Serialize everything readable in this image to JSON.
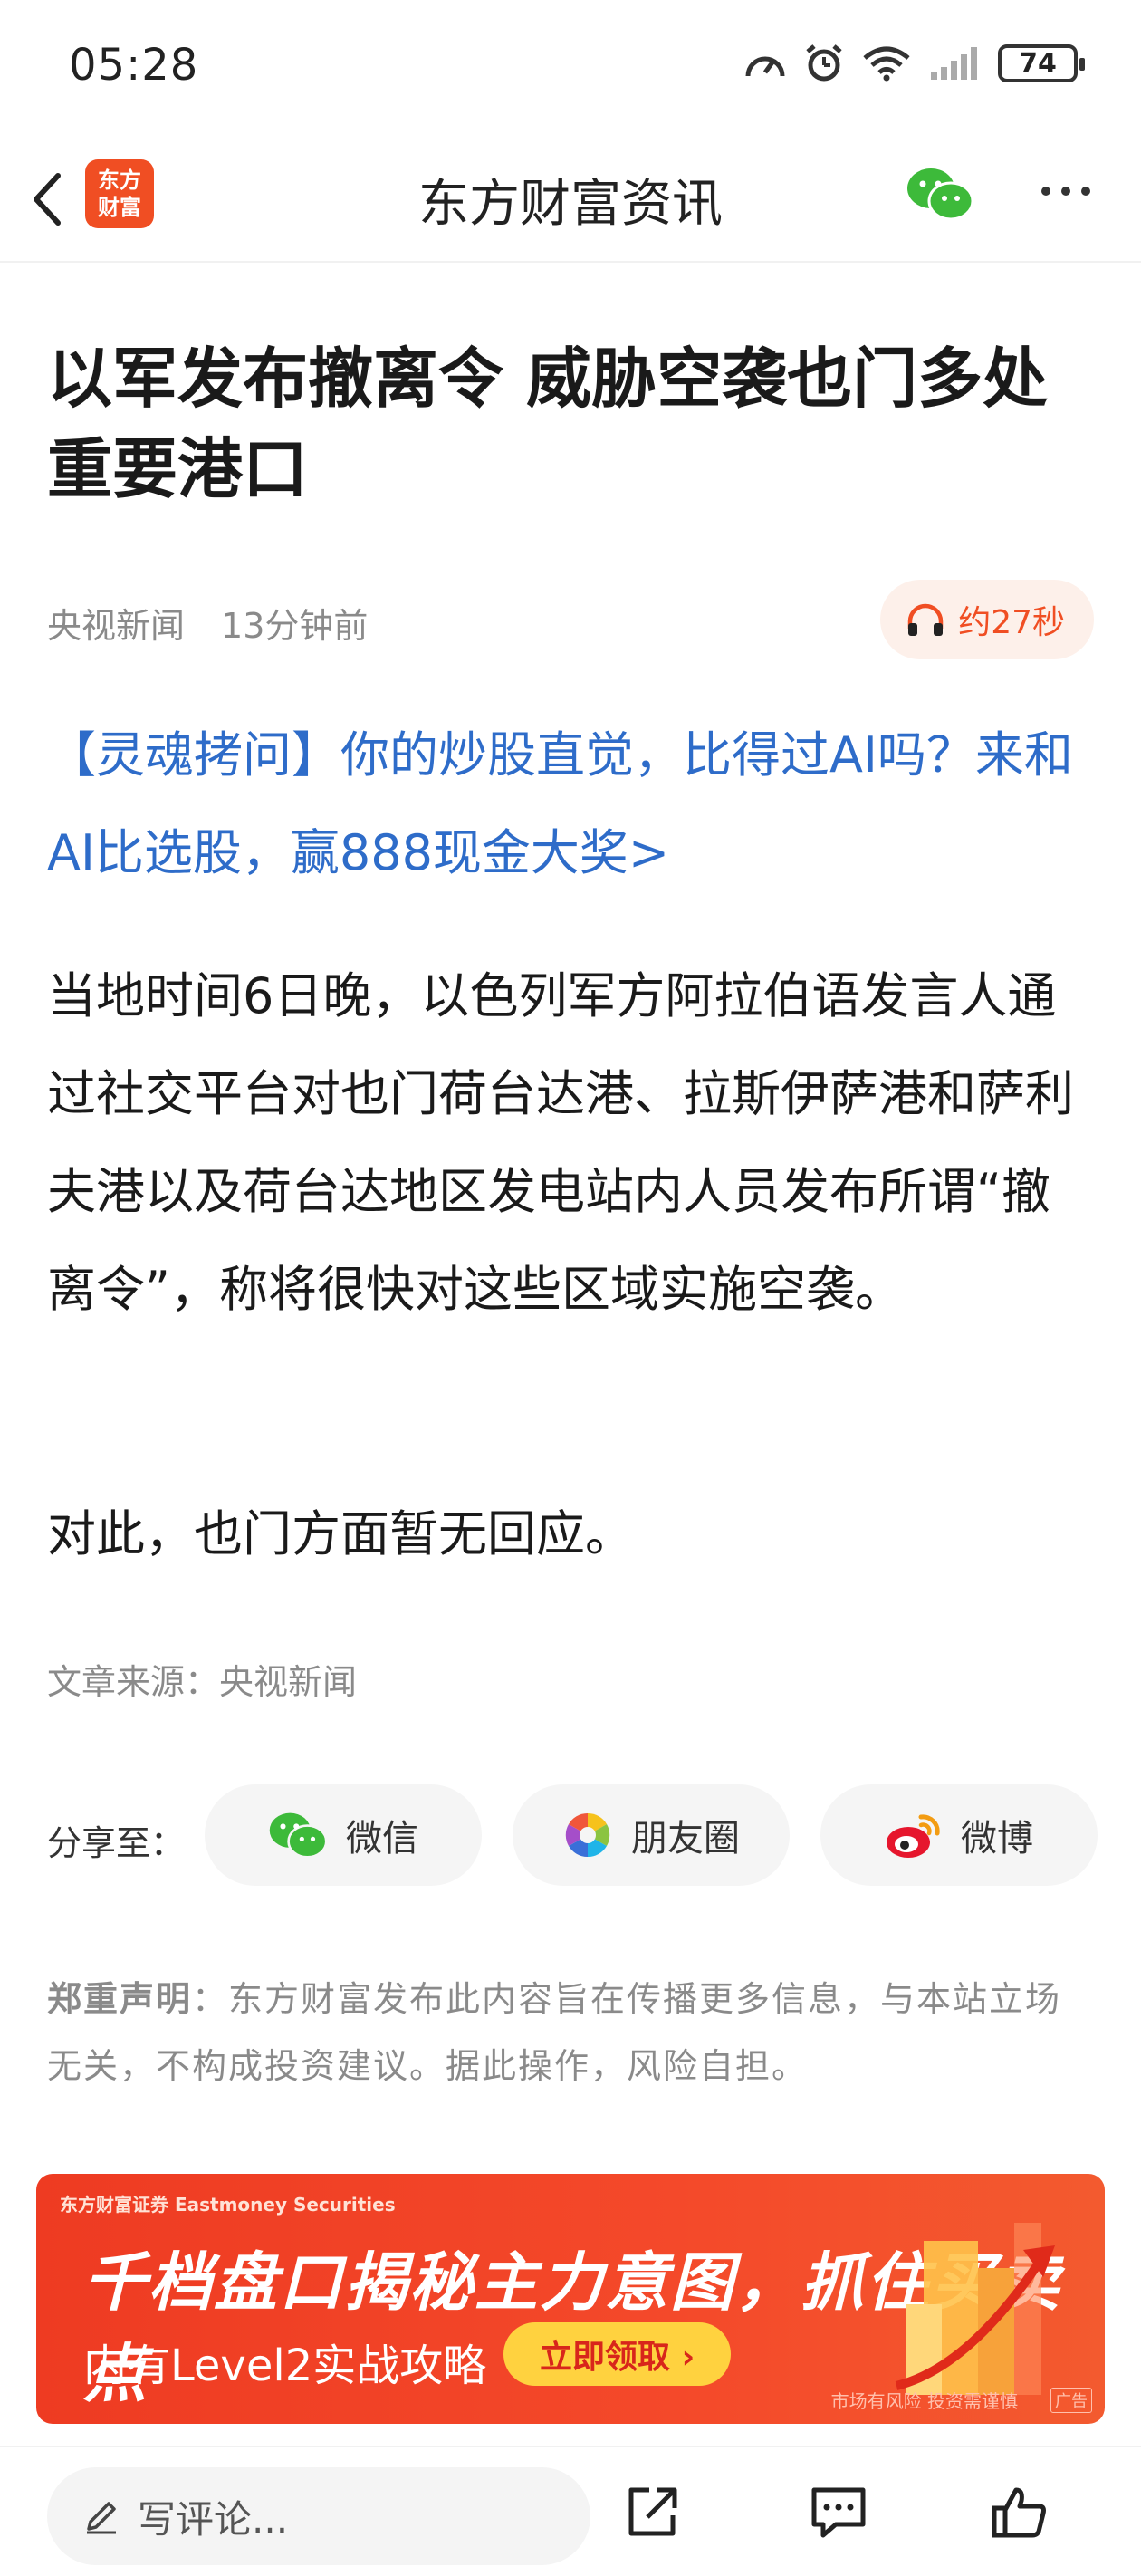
{
  "status_bar": {
    "time": "05:28",
    "battery": "74",
    "icons": [
      "speed-icon",
      "alarm-icon",
      "wifi-icon",
      "signal-icon",
      "battery-icon"
    ]
  },
  "nav": {
    "title": "东方财富资讯",
    "logo_line1": "东方",
    "logo_line2": "财富",
    "icons": [
      "back-icon",
      "wechat-icon",
      "more-icon"
    ]
  },
  "article": {
    "title": "以军发布撤离令 威胁空袭也门多处重要港口",
    "source_name": "央视新闻",
    "time_ago": "13分钟前",
    "audio_label": "约27秒",
    "promo_link": "【灵魂拷问】你的炒股直觉，比得过AI吗？来和AI比选股，赢888现金大奖>",
    "paragraphs": [
      "当地时间6日晚，以色列军方阿拉伯语发言人通过社交平台对也门荷台达港、拉斯伊萨港和萨利夫港以及荷台达地区发电站内人员发布所谓“撤离令”，称将很快对这些区域实施空袭。",
      "对此，也门方面暂无回应。"
    ],
    "source_label": "文章来源：央视新闻"
  },
  "share": {
    "label": "分享至：",
    "wechat": "微信",
    "moments": "朋友圈",
    "weibo": "微博"
  },
  "disclaimer": {
    "title": "郑重声明",
    "text": "：东方财富发布此内容旨在传播更多信息，与本站立场无关，不构成投资建议。据此操作，风险自担。"
  },
  "ad": {
    "brand": "东方财富证券 Eastmoney Securities",
    "headline": "千档盘口揭秘主力意图，抓住买卖点",
    "subline": "内有Level2实战攻略",
    "cta": "立即领取 ›",
    "risk": "市场有风险 投资需谨慎",
    "tag": "广告"
  },
  "bottom_bar": {
    "comment_placeholder": "写评论..."
  },
  "colors": {
    "brand": "#f04e23",
    "link": "#2e6cc9",
    "muted": "#8a8a8a"
  }
}
